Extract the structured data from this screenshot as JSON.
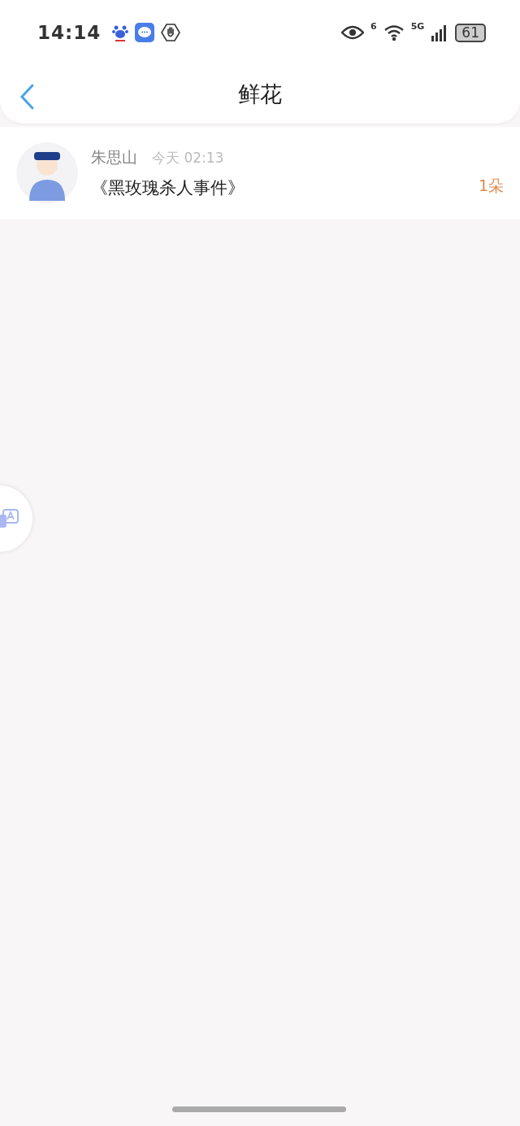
{
  "status_bar": {
    "time": "14:14",
    "wifi_label": "6",
    "network": "5G",
    "battery": "61"
  },
  "header": {
    "title": "鲜花"
  },
  "items": [
    {
      "name": "朱思山",
      "time": "今天 02:13",
      "title": "《黑玫瑰杀人事件》",
      "count": "1朵"
    }
  ]
}
